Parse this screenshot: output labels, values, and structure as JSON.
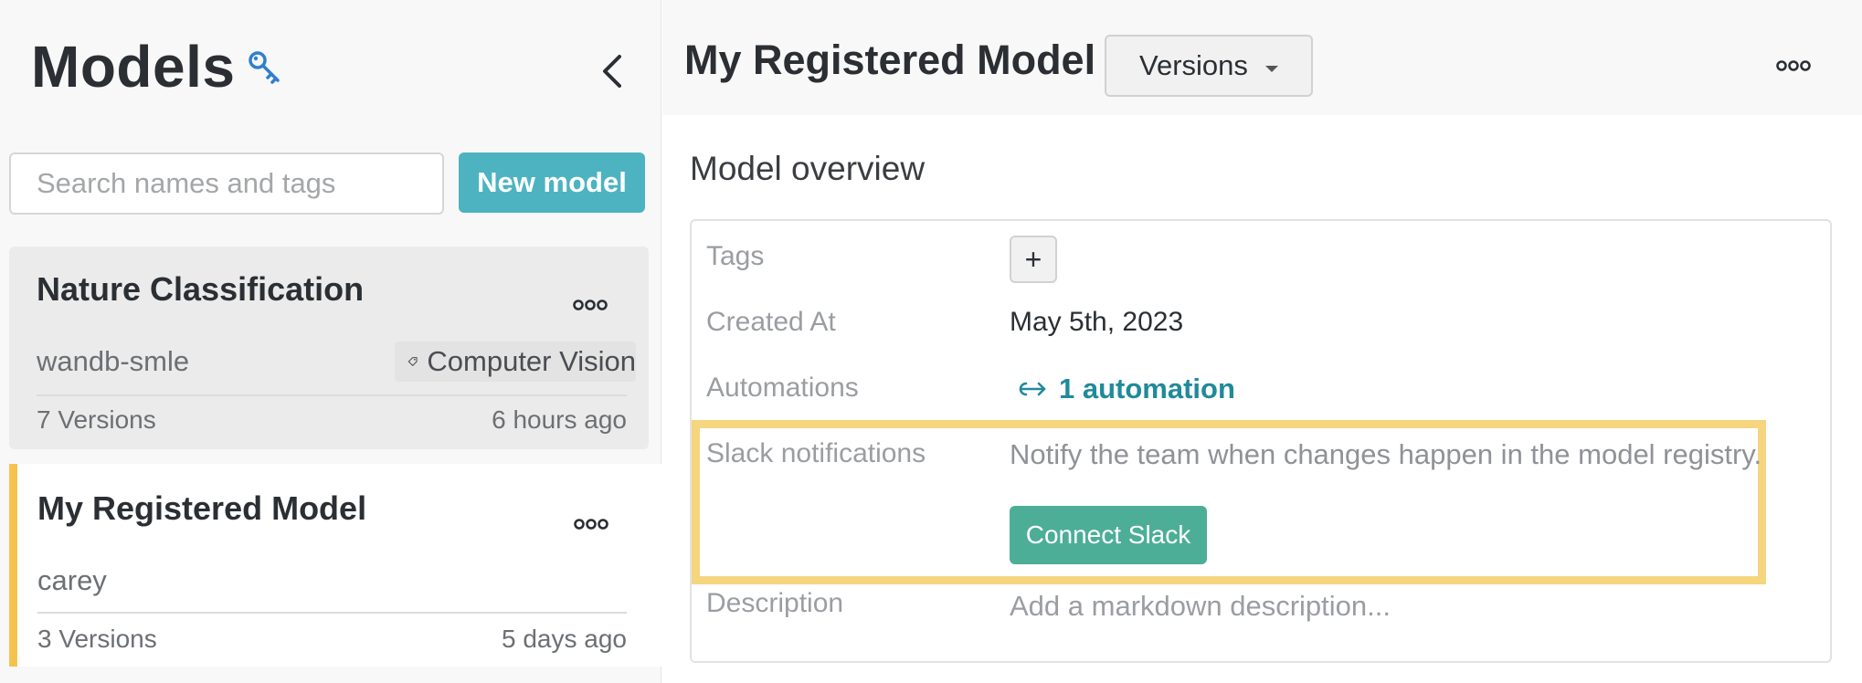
{
  "sidebar": {
    "title": "Models",
    "search_placeholder": "Search names and tags",
    "new_model_label": "New model",
    "cards": [
      {
        "name": "Nature Classification",
        "owner": "wandb-smle",
        "tag": "Computer Vision",
        "versions": "7 Versions",
        "updated": "6 hours ago"
      },
      {
        "name": "My Registered Model",
        "owner": "carey",
        "versions": "3 Versions",
        "updated": "5 days ago"
      }
    ]
  },
  "header": {
    "title": "My Registered Model",
    "versions_label": "Versions"
  },
  "overview": {
    "section_title": "Model overview",
    "tags_label": "Tags",
    "tags_add": "+",
    "created_label": "Created At",
    "created_value": "May 5th, 2023",
    "automations_label": "Automations",
    "automations_value": "1 automation",
    "slack_label": "Slack notifications",
    "slack_description": "Notify the team when changes happen in the model registry.",
    "connect_slack_label": "Connect Slack",
    "description_label": "Description",
    "description_placeholder": "Add a markdown description..."
  },
  "colors": {
    "accent_teal": "#4db3c1",
    "connect_green": "#4cae97",
    "highlight_yellow": "#f5d67f",
    "selected_border": "#f5c34d",
    "link_teal": "#1f8a9a"
  },
  "icons": [
    "key-icon",
    "chevron-left-icon",
    "more-horizontal-icon",
    "tag-icon",
    "caret-down-icon",
    "link-arrow-icon"
  ]
}
